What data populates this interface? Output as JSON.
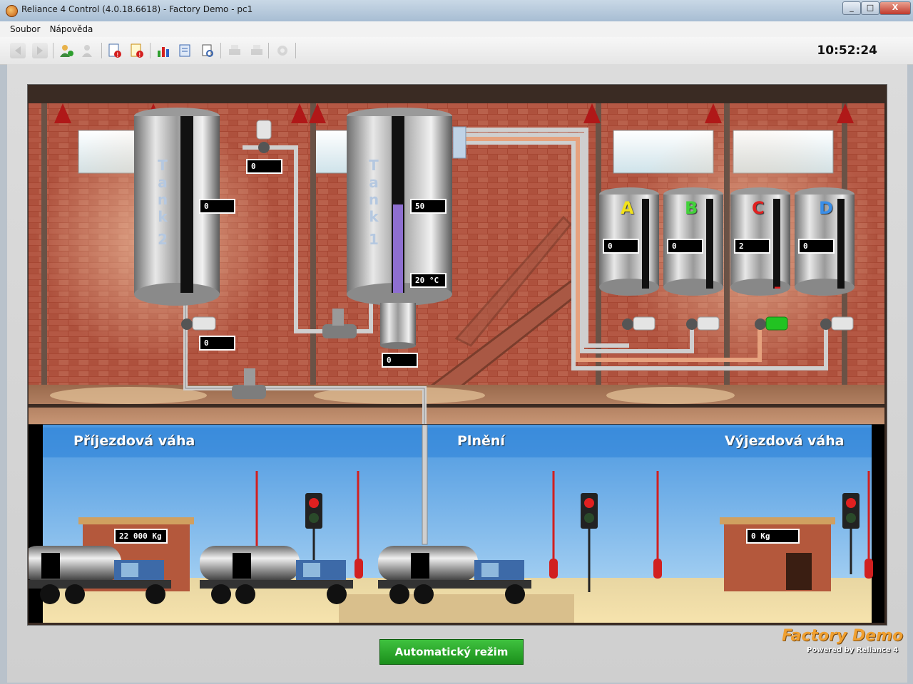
{
  "window": {
    "title": "Reliance 4 Control (4.0.18.6618) - Factory Demo - pc1",
    "controls": [
      "_",
      "□",
      "X"
    ]
  },
  "menu": {
    "items": [
      "Soubor",
      "Nápověda"
    ]
  },
  "toolbar": {
    "clock": "10:52:24"
  },
  "tanks": {
    "tank2": {
      "label": [
        "T",
        "a",
        "n",
        "k",
        "2"
      ],
      "level_display": "0",
      "outlet_display": "0",
      "valve_display": "0",
      "level_fraction": 0
    },
    "tank1": {
      "label": [
        "T",
        "a",
        "n",
        "k",
        "1"
      ],
      "level_display": "50",
      "temperature_display": "20 °C",
      "heater_display": "0",
      "level_fraction": 0.5
    }
  },
  "small_tanks": [
    {
      "letter": "A",
      "value": "0",
      "color": "#f2e21a",
      "level_fraction": 0
    },
    {
      "letter": "B",
      "value": "0",
      "color": "#42d23a",
      "level_fraction": 0
    },
    {
      "letter": "C",
      "value": "2",
      "color": "#e02020",
      "level_fraction": 0.02
    },
    {
      "letter": "D",
      "value": "0",
      "color": "#3a8ee8",
      "level_fraction": 0
    }
  ],
  "yard": {
    "arrival_title": "Příjezdová váha",
    "filling_title": "Plnění",
    "departure_title": "Výjezdová váha",
    "arrival_weight": "22 000 Kg",
    "departure_weight": "0 Kg"
  },
  "buttons": {
    "auto_mode": "Automatický režim"
  },
  "brand": {
    "name": "Factory Demo",
    "powered": "Powered by Reliance 4"
  },
  "colors": {
    "liquid": "#8e6fd0",
    "accent_green": "#22a322"
  }
}
